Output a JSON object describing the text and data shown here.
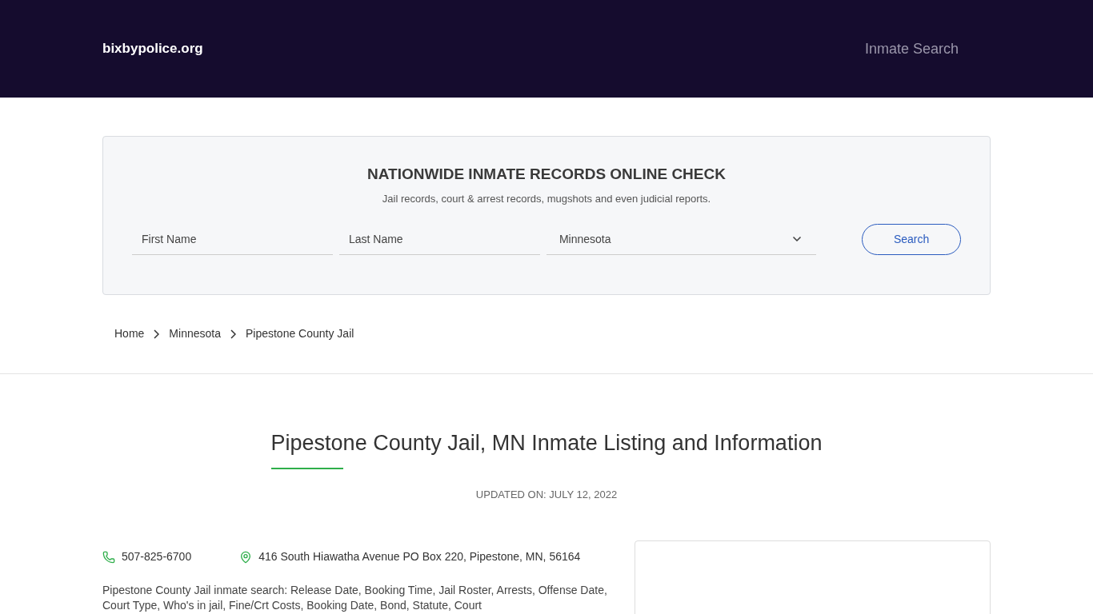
{
  "header": {
    "site_name": "bixbypolice.org",
    "nav": [
      "Inmate Search"
    ]
  },
  "search_panel": {
    "title": "NATIONWIDE INMATE RECORDS ONLINE CHECK",
    "subtitle": "Jail records, court & arrest records, mugshots and even judicial reports.",
    "first_name": {
      "placeholder": "First Name"
    },
    "last_name": {
      "placeholder": "Last Name"
    },
    "state": {
      "value": "Minnesota"
    },
    "button": "Search"
  },
  "breadcrumbs": [
    "Home",
    "Minnesota",
    "Pipestone County Jail"
  ],
  "page": {
    "title": "Pipestone County Jail, MN Inmate Listing and Information",
    "updated": "UPDATED ON: JULY 12, 2022",
    "phone": "507-825-6700",
    "address": "416 South Hiawatha Avenue PO Box 220, Pipestone, MN, 56164",
    "description": "Pipestone County Jail inmate search: Release Date, Booking Time, Jail Roster, Arrests, Offense Date, Court Type, Who's in jail, Fine/Crt Costs, Booking Date, Bond, Statute, Court"
  }
}
